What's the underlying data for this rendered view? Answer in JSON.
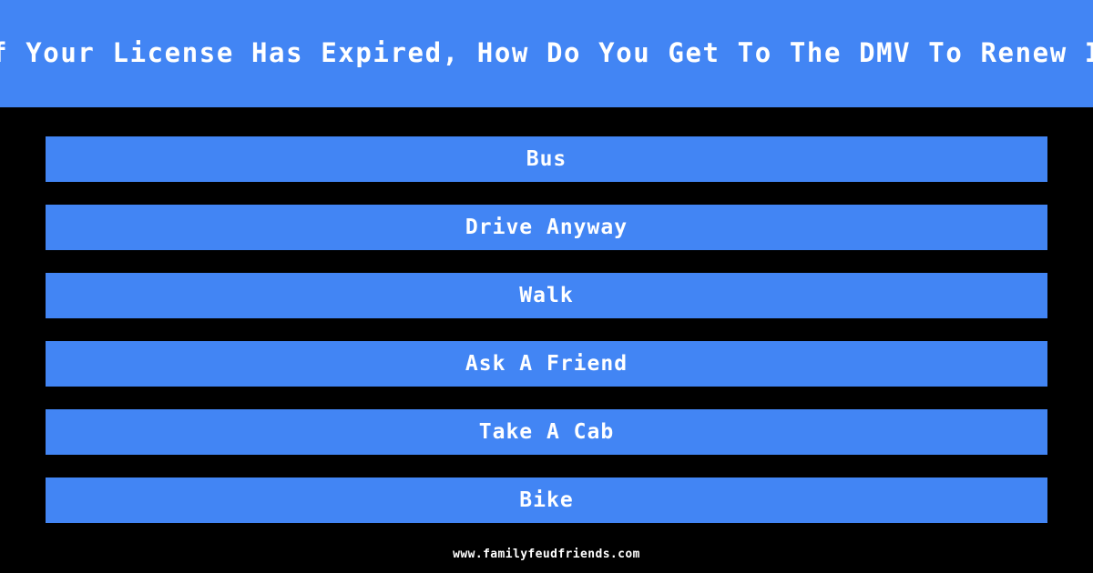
{
  "theme": {
    "background_color": "#000000",
    "accent_color": "#4285f4",
    "text_color": "#ffffff"
  },
  "header": {
    "title": "If Your License Has Expired, How Do You Get To The DMV To Renew It"
  },
  "answers": [
    {
      "label": "Bus"
    },
    {
      "label": "Drive Anyway"
    },
    {
      "label": "Walk"
    },
    {
      "label": "Ask A Friend"
    },
    {
      "label": "Take A Cab"
    },
    {
      "label": "Bike"
    }
  ],
  "footer": {
    "url": "www.familyfeudfriends.com"
  }
}
